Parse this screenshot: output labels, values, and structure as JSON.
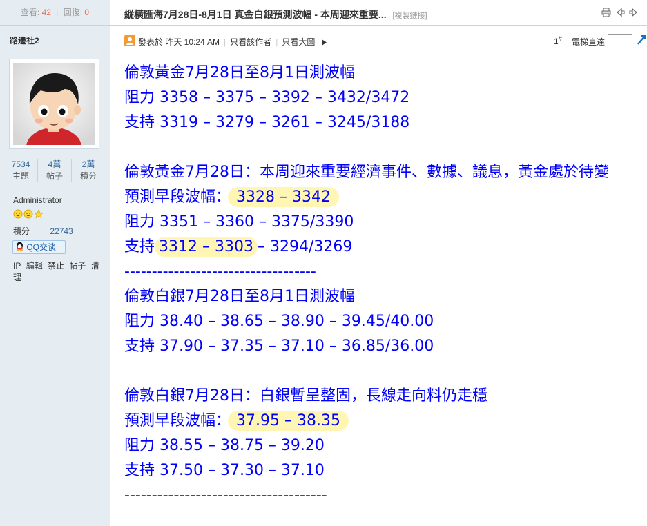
{
  "sidebar": {
    "views_label": "查看:",
    "views": "42",
    "replies_label": "回復:",
    "replies": "0",
    "username": "路邊社2",
    "stats": [
      {
        "value": "7534",
        "label": "主題"
      },
      {
        "value": "4萬",
        "label": "帖子"
      },
      {
        "value": "2萬",
        "label": "積分"
      }
    ],
    "role": "Administrator",
    "points_label": "積分",
    "points": "22743",
    "qq_label": "QQ交谈",
    "admin_links": [
      "IP",
      "編輯",
      "禁止",
      "帖子",
      "清理"
    ]
  },
  "thread": {
    "title": "縱橫匯海7月28日-8月1日 真金白銀預測波幅 - 本周迎來重要...",
    "copy_link": "[複製鏈接]"
  },
  "meta": {
    "posted": "發表於 昨天 10:24 AM",
    "only_author": "只看該作者",
    "large_image": "只看大圖",
    "floor": "1",
    "floor_sup": "#",
    "jump_label": "電梯直達"
  },
  "post": {
    "g1_title": "倫敦黃金7月28日至8月1日測波幅",
    "g1_res": "阻力 3358 – 3375 – 3392 – 3432/3472",
    "g1_sup": "支持 3319 – 3279 – 3261 – 3245/3188",
    "g2_title": "倫敦黃金7月28日：本周迎來重要經濟事件、數據、議息，黃金處於待變",
    "g2_early_label": "預測早段波幅：",
    "g2_early_value": "3328 – 3342",
    "g2_res": "阻力 3351 – 3360 – 3375/3390",
    "g2_sup_label": "支持",
    "g2_sup_hl": "3312 – 3303",
    "g2_sup_rest": "– 3294/3269",
    "divider1": "-----------------------------------",
    "s1_title": "倫敦白銀7月28日至8月1日測波幅",
    "s1_res": "阻力 38.40 – 38.65 – 38.90 – 39.45/40.00",
    "s1_sup": "支持 37.90 – 37.35 – 37.10 – 36.85/36.00",
    "s2_title": "倫敦白銀7月28日：白銀暫呈整固，長線走向料仍走穩",
    "s2_early_label": "預測早段波幅：",
    "s2_early_value": "37.95 – 38.35",
    "s2_res": "阻力 38.55 – 38.75 – 39.20",
    "s2_sup": "支持 37.50 – 37.30 – 37.10",
    "divider2": "-------------------------------------"
  },
  "colors": {
    "post_text": "#0000ff",
    "highlight": "#fff6b3",
    "sidebar_bg": "#e5edf2",
    "count_accent": "#f26c4f"
  }
}
